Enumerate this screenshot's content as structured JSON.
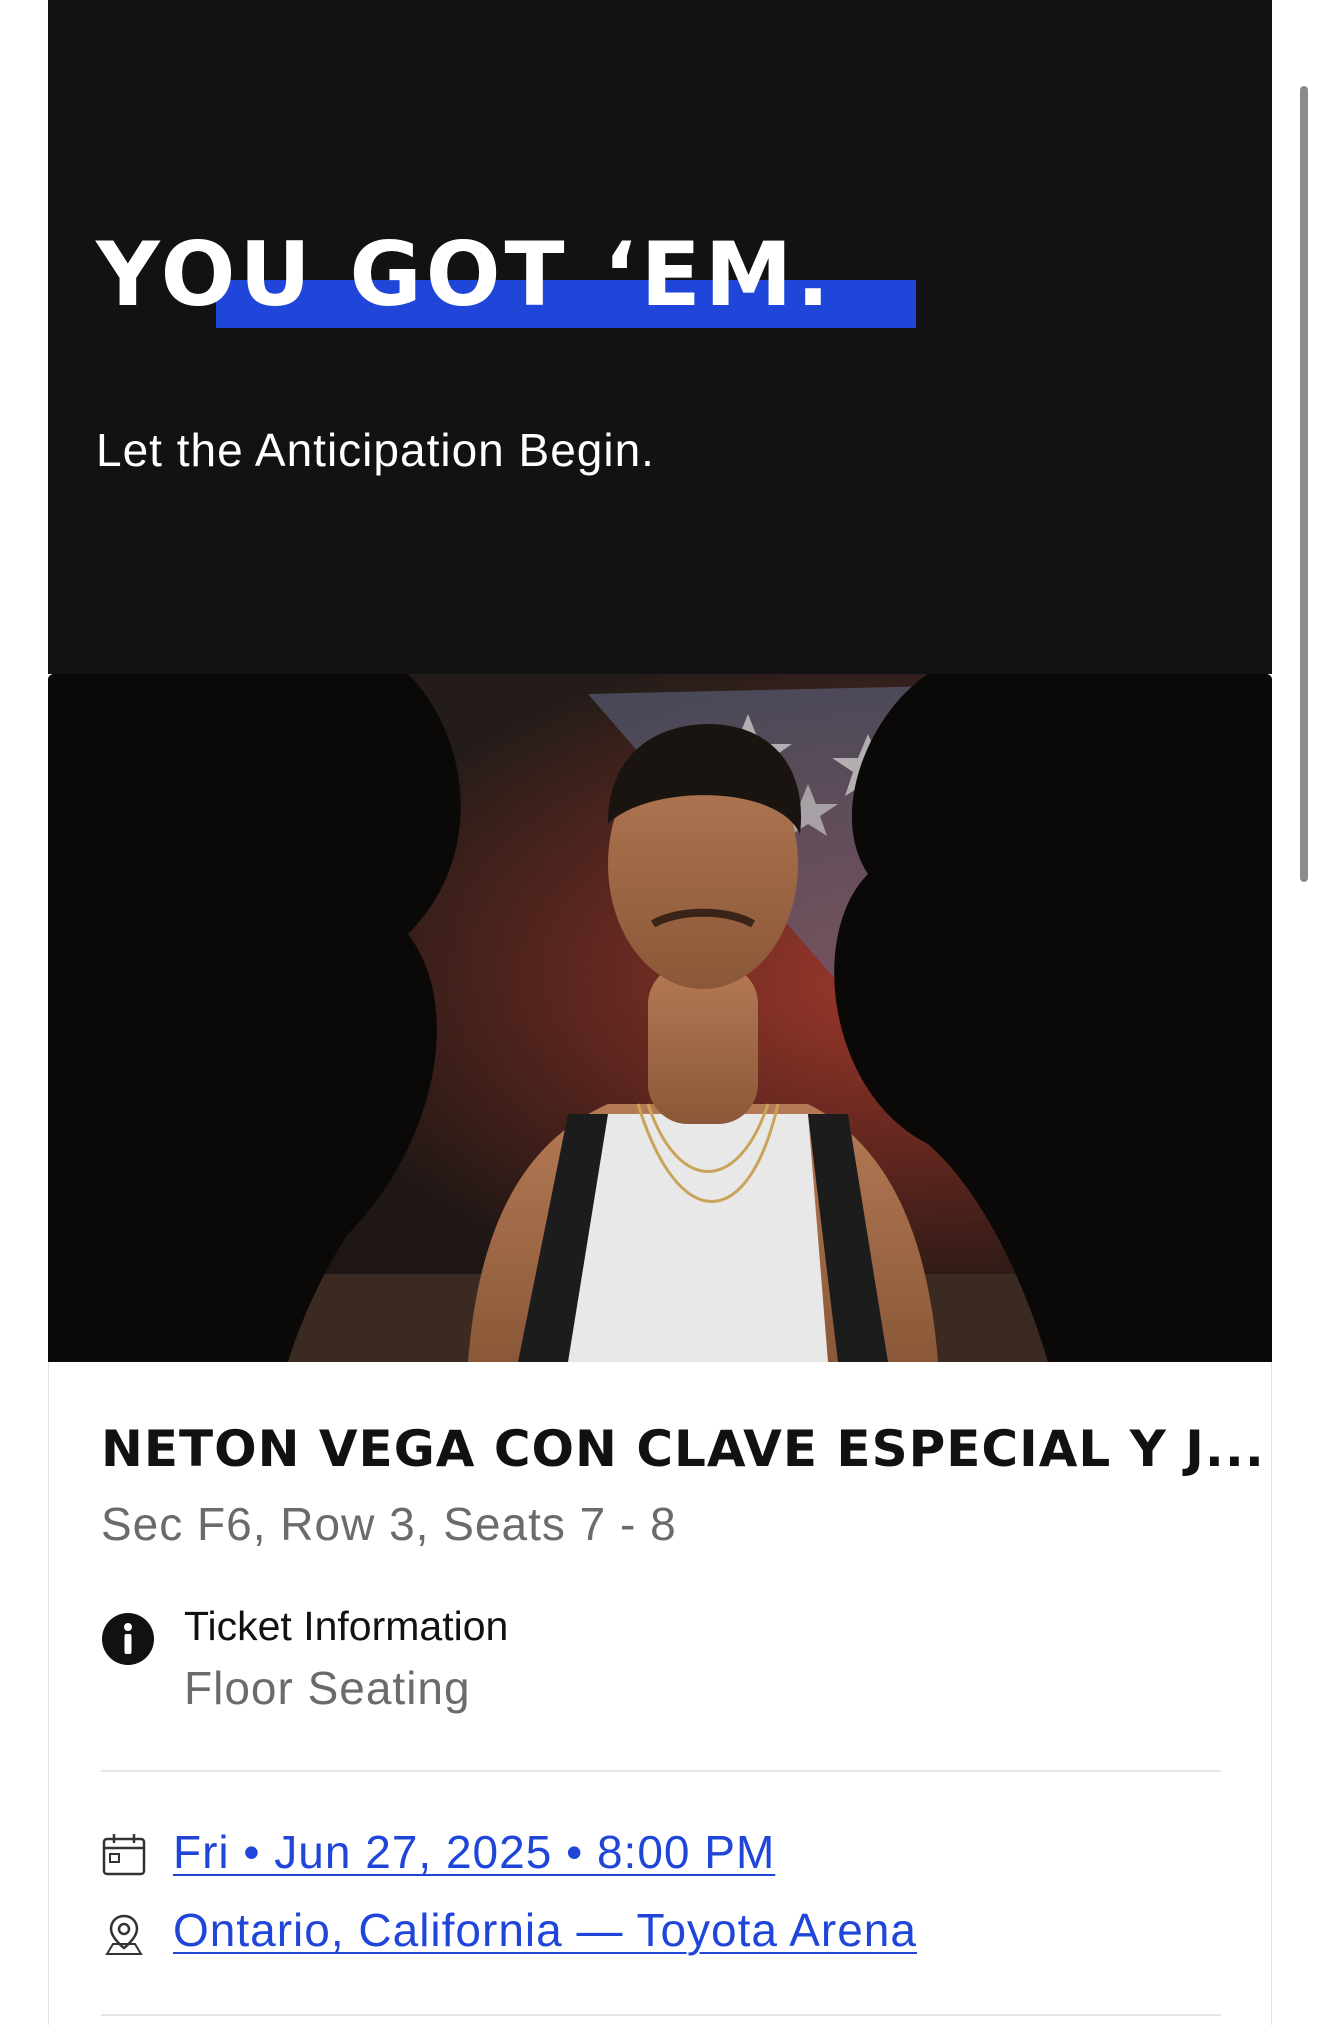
{
  "hero": {
    "title": "YOU GOT ‘EM.",
    "subtitle": "Let the Anticipation Begin."
  },
  "event": {
    "image_alt": "Event artist photo",
    "title": "NETON VEGA CON CLAVE ESPECIAL Y J...",
    "seats": "Sec F6, Row 3, Seats 7 - 8",
    "ticket_info_label": "Ticket Information",
    "ticket_info_value": "Floor Seating",
    "date": "Fri • Jun 27, 2025 • 8:00 PM",
    "venue": "Ontario, California — Toyota Arena"
  },
  "icons": {
    "info": "info-icon",
    "calendar": "calendar-icon",
    "location": "location-pin-icon"
  },
  "colors": {
    "hero_bg": "#121214",
    "accent": "#1f46d8",
    "link": "#1f46d8",
    "muted_text": "#6b6b6b"
  }
}
